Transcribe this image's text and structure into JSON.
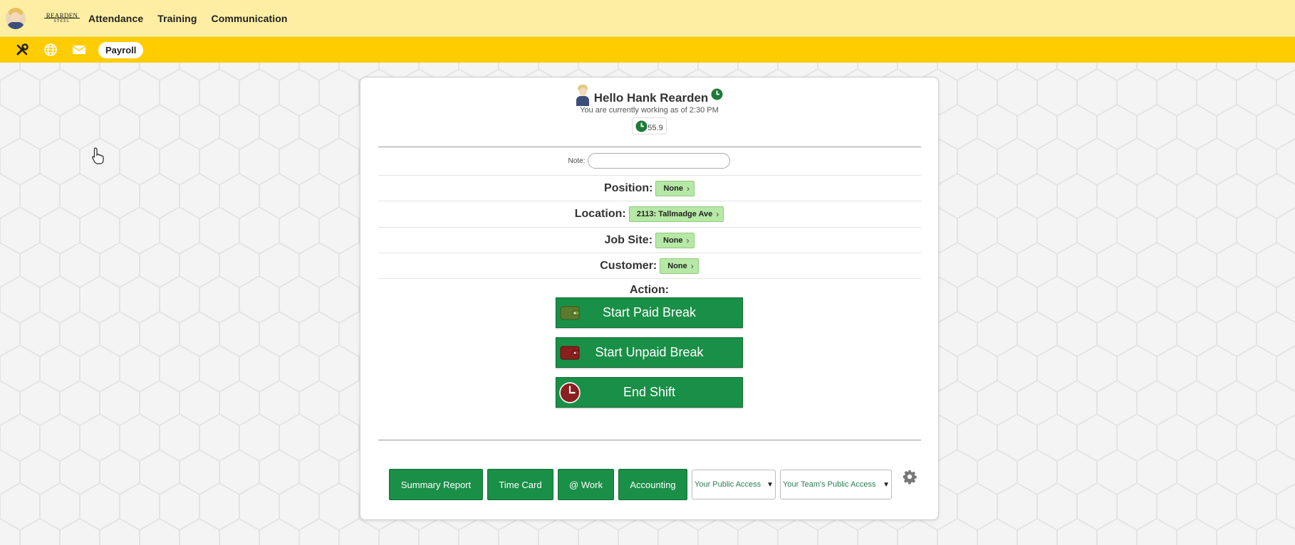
{
  "topbar": {
    "logo_line1": "REARDEN",
    "logo_line2": "STEEL",
    "nav": [
      "Attendance",
      "Training",
      "Communication"
    ]
  },
  "subbar": {
    "icons": [
      "tools-icon",
      "globe-icon",
      "mail-icon"
    ],
    "payroll_label": "Payroll"
  },
  "card": {
    "greeting": "Hello Hank Rearden",
    "status": "You are currently working as of 2:30 PM",
    "hours": "55.9",
    "note_label": "Note:",
    "note_value": "",
    "position": {
      "label": "Position:",
      "value": "None"
    },
    "location": {
      "label": "Location:",
      "value": "2113: Tallmadge Ave"
    },
    "job_site": {
      "label": "Job Site:",
      "value": "None"
    },
    "customer": {
      "label": "Customer:",
      "value": "None"
    },
    "action_label": "Action:",
    "actions": {
      "paid_break": "Start Paid Break",
      "unpaid_break": "Start Unpaid Break",
      "end_shift": "End Shift"
    }
  },
  "bottom": {
    "summary_report": "Summary Report",
    "time_card": "Time Card",
    "at_work": "@ Work",
    "accounting": "Accounting",
    "public_access": "Your Public Access",
    "team_public_access": "Your Team's Public Access"
  },
  "colors": {
    "topbar": "#fdeea3",
    "subbar": "#ffcc00",
    "action_green": "#1a8f47",
    "pill_green": "#b6e8a6"
  }
}
